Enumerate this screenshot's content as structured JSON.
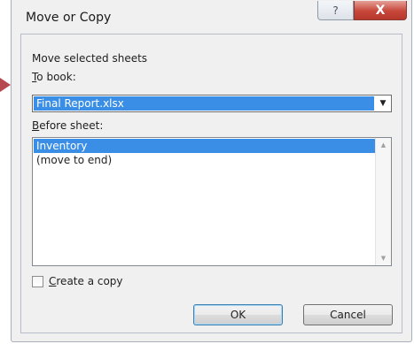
{
  "dialog": {
    "title": "Move or Copy",
    "help_glyph": "?",
    "close_glyph": "X"
  },
  "labels": {
    "move_selected": "Move selected sheets",
    "to_book_prefix": "T",
    "to_book_rest": "o book:",
    "before_sheet_prefix": "B",
    "before_sheet_rest": "efore sheet:"
  },
  "to_book": {
    "selected_value": "Final Report.xlsx",
    "arrow_glyph": "▼"
  },
  "before_sheet": {
    "items": [
      {
        "label": "Inventory",
        "selected": true
      },
      {
        "label": "(move to end)",
        "selected": false
      }
    ],
    "scroll_up_glyph": "▲",
    "scroll_down_glyph": "▼"
  },
  "create_copy": {
    "checked": false,
    "label_prefix": "C",
    "label_rest": "reate a copy"
  },
  "buttons": {
    "ok": "OK",
    "cancel": "Cancel"
  },
  "colors": {
    "selection": "#3a8ee6",
    "close_button": "#c7463a",
    "pointer_arrow": "#b6484f"
  }
}
